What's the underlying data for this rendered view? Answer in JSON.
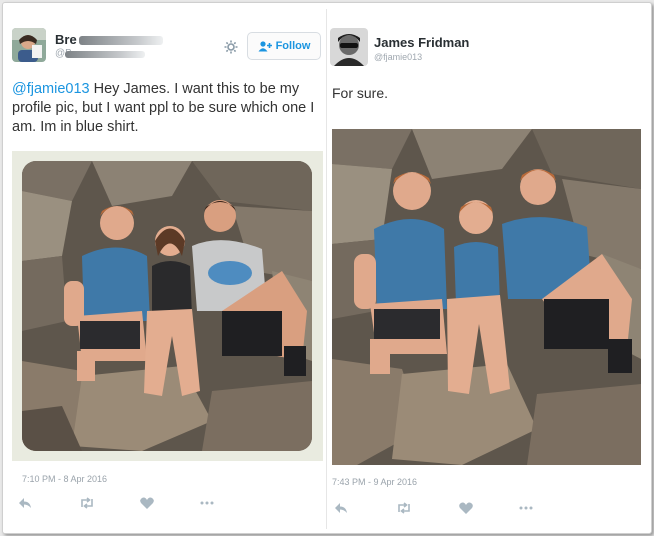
{
  "left_tweet": {
    "name": "Bre",
    "handle": "@B",
    "follow_label": "Follow",
    "icons": [
      "gear-icon",
      "follow-person-icon"
    ],
    "mention": "@fjamie013",
    "text_lines": [
      " Hey James. I want this to be my",
      "profile pic, but I want ppl to be sure which one I",
      "am. Im in blue shirt."
    ],
    "timestamp": "7:10 PM - 8 Apr 2016",
    "actions": [
      "reply-icon",
      "retweet-icon",
      "like-icon",
      "more-icon"
    ]
  },
  "right_tweet": {
    "name": "James Fridman",
    "handle": "@fjamie013",
    "text": "For sure.",
    "timestamp": "7:43 PM - 9 Apr 2016",
    "actions": [
      "reply-icon",
      "retweet-icon",
      "like-icon",
      "more-icon"
    ]
  },
  "colors": {
    "accent": "#1b95e0",
    "text": "#333333",
    "meta": "#9aa3ab"
  }
}
